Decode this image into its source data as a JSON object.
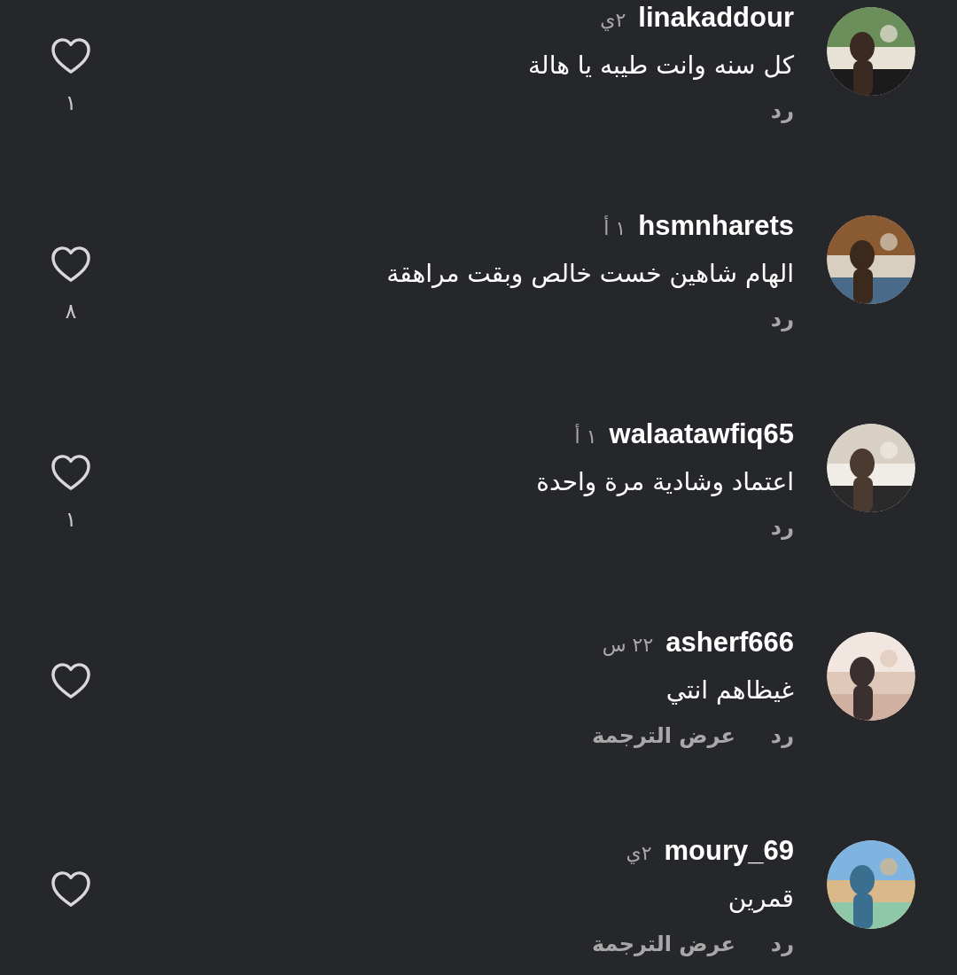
{
  "comments": [
    {
      "username": "linakaddour",
      "time": "٢ي",
      "text": "كل سنه وانت طيبه يا هالة",
      "actions": [
        "رد"
      ],
      "likes": "١",
      "avatar": {
        "kind": "picture"
      }
    },
    {
      "username": "hsmnharets",
      "time": "١ أ",
      "text": "الهام شاهين خست خالص وبقت مراهقة",
      "actions": [
        "رد"
      ],
      "likes": "٨",
      "avatar": {
        "kind": "picture"
      }
    },
    {
      "username": "walaatawfiq65",
      "time": "١ أ",
      "text": "اعتماد وشادية مرة واحدة",
      "actions": [
        "رد"
      ],
      "likes": "١",
      "avatar": {
        "kind": "picture"
      }
    },
    {
      "username": "asherf666",
      "time": "٢٢ س",
      "text": "غيظاهم انتي",
      "actions": [
        "رد",
        "عرض الترجمة"
      ],
      "avatar": {
        "kind": "picture"
      }
    },
    {
      "username": "moury_69",
      "time": "٢ي",
      "text": "قمرين",
      "actions": [
        "رد",
        "عرض الترجمة"
      ],
      "avatar": {
        "kind": "picture"
      }
    }
  ]
}
